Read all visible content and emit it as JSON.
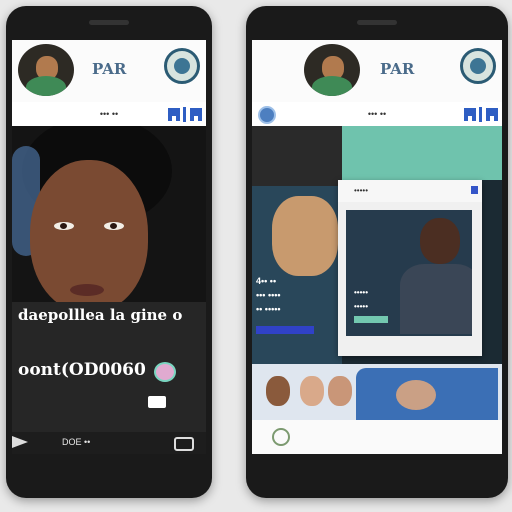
{
  "left_phone": {
    "header": {
      "brand": "PAR"
    },
    "subbar": {
      "text": "••• ••"
    },
    "post": {
      "caption": "daepolllea la gine o",
      "counter": "oont(OD0060"
    },
    "bottom_bar": {
      "label": "DOE ••"
    }
  },
  "right_phone": {
    "header": {
      "brand": "PAR"
    },
    "subbar": {
      "text": "••• ••"
    },
    "feed": {
      "labels": [
        "4•• ••",
        "••• ••••",
        "•• •••••"
      ]
    },
    "popup": {
      "header_text": "•••••",
      "labels": [
        "•••••",
        "•••••"
      ]
    }
  },
  "colors": {
    "accent": "#2f5ec3",
    "teal": "#6fc3ad",
    "phone_body": "#1a1a1a"
  }
}
